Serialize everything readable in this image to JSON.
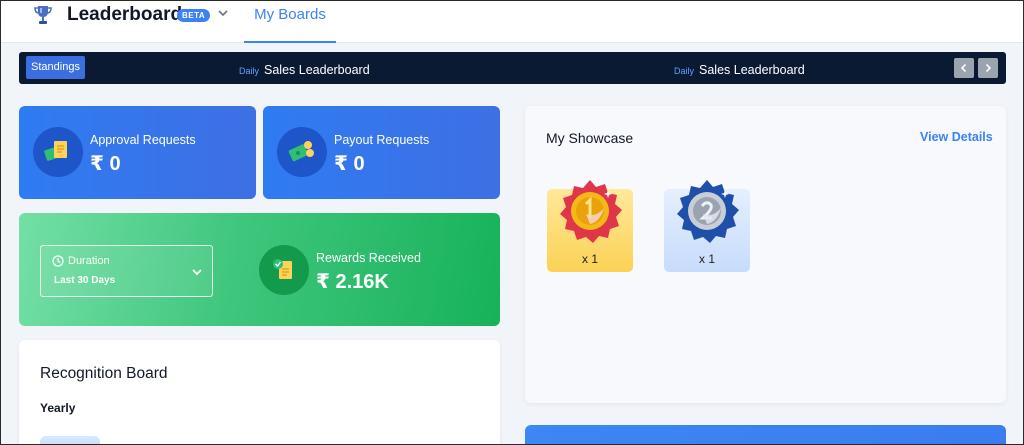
{
  "header": {
    "app_title": "Leaderboards",
    "beta_badge": "BETA",
    "tab_label": "My Boards",
    "icons": [
      "trophy-icon",
      "chevron-down-icon"
    ]
  },
  "ticker": {
    "standings_label": "Standings",
    "items": [
      {
        "period": "Daily",
        "name": "Sales Leaderboard"
      },
      {
        "period": "Daily",
        "name": "Sales Leaderboard"
      }
    ],
    "icons": [
      "chevron-left-icon",
      "chevron-right-icon"
    ]
  },
  "approval": {
    "label": "Approval Requests",
    "value": "₹ 0"
  },
  "payout": {
    "label": "Payout Requests",
    "value": "₹ 0"
  },
  "rewards": {
    "duration_label": "Duration",
    "duration_value": "Last 30 Days",
    "label": "Rewards Received",
    "value": "₹ 2.16K"
  },
  "recognition": {
    "title": "Recognition Board",
    "period": "Yearly"
  },
  "showcase": {
    "title": "My Showcase",
    "view_details": "View Details",
    "medals": [
      {
        "rank": "1",
        "count": "x 1",
        "color": "#fbd255"
      },
      {
        "rank": "2",
        "count": "x 1",
        "color": "#c7dcfb"
      }
    ]
  },
  "colors": {
    "accent": "#3b82f6",
    "ticker_bg": "#0a1a33",
    "card_blue": "#3e74e8",
    "card_green": "#17b25a"
  }
}
